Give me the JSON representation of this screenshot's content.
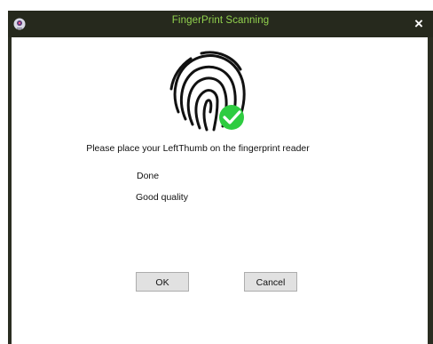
{
  "window": {
    "title": "FingerPrint Scanning",
    "close_label": "×",
    "title_color": "#92d24e",
    "frame_color": "#2a2d21",
    "app_icon": "webcam-icon"
  },
  "content": {
    "fingerprint_icon": "fingerprint-icon",
    "success_badge_icon": "checkmark-circle-icon",
    "success_color": "#2ecc40",
    "prompt": "Please place your LeftThumb on the fingerprint reader",
    "status": "Done",
    "quality": "Good quality"
  },
  "buttons": {
    "ok_label": "OK",
    "cancel_label": "Cancel"
  }
}
